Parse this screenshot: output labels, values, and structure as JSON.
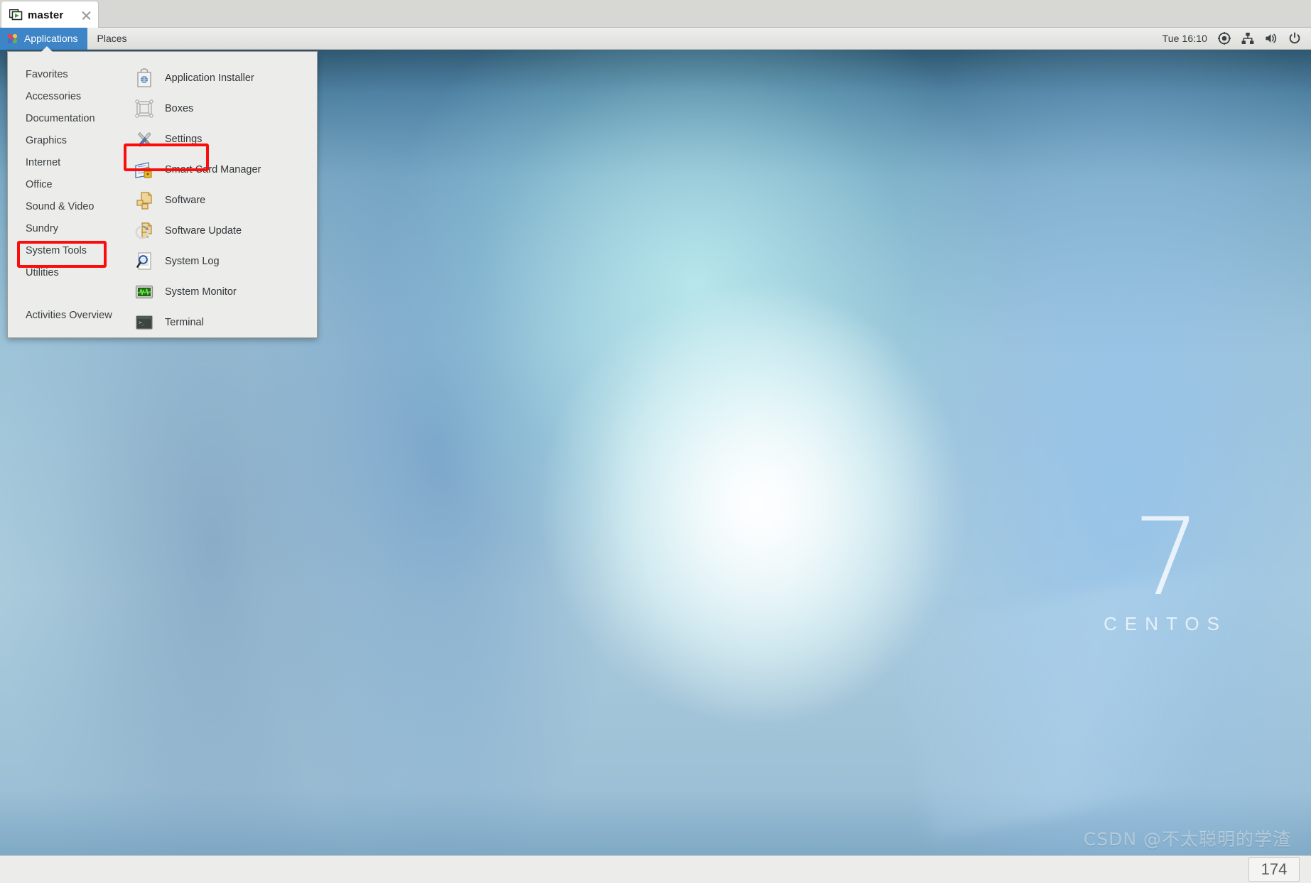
{
  "window": {
    "tab_title": "master",
    "tab_icon": "virtual-machine-icon",
    "close_icon": "close-icon"
  },
  "panel": {
    "applications_label": "Applications",
    "applications_icon": "gnome-foot-icon",
    "places_label": "Places",
    "clock": "Tue 16:10",
    "tray": [
      {
        "name": "accessibility-icon",
        "glyph": "◉"
      },
      {
        "name": "network-icon",
        "glyph": "⑂"
      },
      {
        "name": "volume-icon",
        "glyph": "ὐA"
      },
      {
        "name": "power-icon",
        "glyph": "⏻"
      }
    ]
  },
  "apps_menu": {
    "categories": [
      {
        "label": "Favorites",
        "selected": false
      },
      {
        "label": "Accessories",
        "selected": false
      },
      {
        "label": "Documentation",
        "selected": false
      },
      {
        "label": "Graphics",
        "selected": false
      },
      {
        "label": "Internet",
        "selected": false
      },
      {
        "label": "Office",
        "selected": false
      },
      {
        "label": "Sound & Video",
        "selected": false
      },
      {
        "label": "Sundry",
        "selected": false
      },
      {
        "label": "System Tools",
        "selected": true
      },
      {
        "label": "Utilities",
        "selected": false
      }
    ],
    "overview_label": "Activities Overview",
    "applications": [
      {
        "label": "Application Installer",
        "icon": "application-installer-icon"
      },
      {
        "label": "Boxes",
        "icon": "boxes-icon"
      },
      {
        "label": "Settings",
        "icon": "settings-tools-icon"
      },
      {
        "label": "Smart Card Manager",
        "icon": "smart-card-icon"
      },
      {
        "label": "Software",
        "icon": "software-package-icon"
      },
      {
        "label": "Software Update",
        "icon": "software-update-icon"
      },
      {
        "label": "System Log",
        "icon": "system-log-icon"
      },
      {
        "label": "System Monitor",
        "icon": "system-monitor-icon"
      },
      {
        "label": "Terminal",
        "icon": "terminal-icon"
      }
    ]
  },
  "desktop": {
    "brand_version": "7",
    "brand_name": "CENTOS",
    "watermark": "CSDN @不太聪明的学渣"
  },
  "host_bottom": {
    "page_counter": "174"
  },
  "colors": {
    "panel_accent": "#3d85c6",
    "annotation_red": "#fb0d0b",
    "menu_bg": "#ececea",
    "desktop_base": "#7ba7c6"
  }
}
